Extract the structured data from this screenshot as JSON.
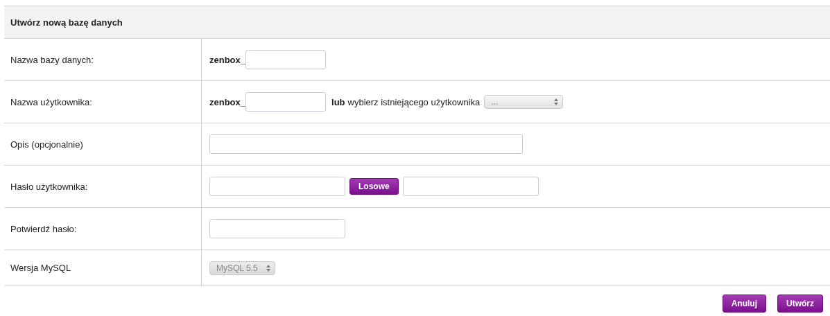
{
  "form": {
    "title": "Utwórz nową bazę danych",
    "rows": [
      {
        "label": "Nazwa bazy danych:",
        "items": [
          {
            "kind": "prefix",
            "text": "zenbox_"
          },
          {
            "kind": "input"
          }
        ]
      },
      {
        "label": "Nazwa użytkownika:",
        "items": [
          {
            "kind": "prefix",
            "text": "zenbox_"
          },
          {
            "kind": "input"
          },
          {
            "kind": "bold",
            "text": "lub"
          },
          {
            "kind": "text",
            "text": "wybierz istniejącego użytkownika"
          },
          {
            "kind": "select",
            "value": "...",
            "disabled": false
          }
        ]
      },
      {
        "label": "Opis (opcjonalnie)",
        "items": [
          {
            "kind": "input"
          }
        ]
      },
      {
        "label": "Hasło użytkownika:",
        "items": [
          {
            "kind": "input"
          },
          {
            "kind": "button",
            "text": "Losowe"
          },
          {
            "kind": "input"
          }
        ]
      },
      {
        "label": "Potwierdź hasło:",
        "items": [
          {
            "kind": "input"
          }
        ]
      },
      {
        "label": "Wersja MySQL",
        "items": [
          {
            "kind": "select",
            "value": "MySQL 5.5",
            "disabled": true
          }
        ]
      }
    ]
  },
  "buttons": [
    "Anuluj",
    "Utwórz"
  ]
}
